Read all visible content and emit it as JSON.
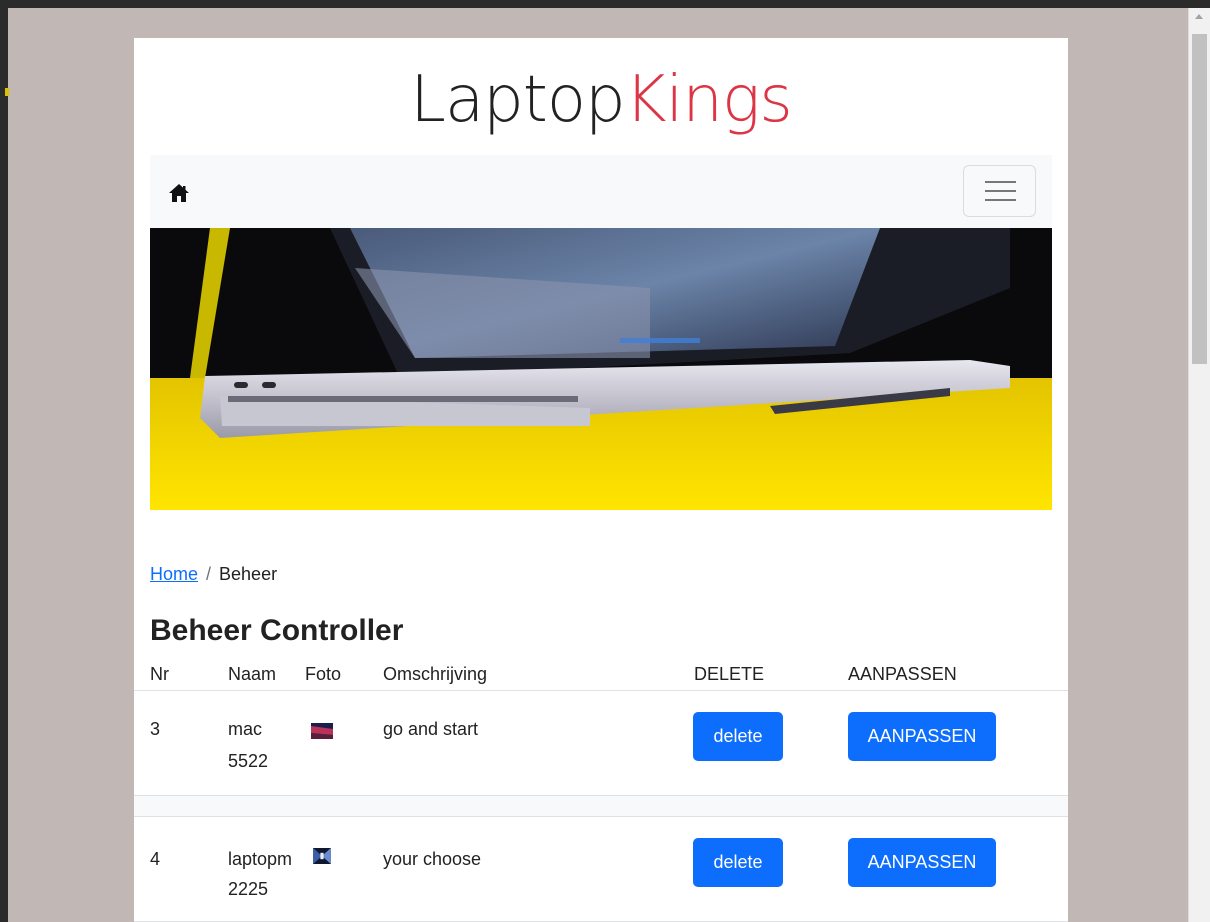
{
  "brand": {
    "part1": "Laptop",
    "part2": "Kings"
  },
  "navbar": {
    "home_icon": "home-icon",
    "toggler_icon": "hamburger-icon"
  },
  "breadcrumb": {
    "home": "Home",
    "separator": "/",
    "current": "Beheer"
  },
  "page_title": "Beheer Controller",
  "table": {
    "headers": [
      "Nr",
      "Naam",
      "Foto",
      "Omschrijving",
      "DELETE",
      "AANPASSEN"
    ],
    "rows": [
      {
        "nr": "3",
        "naam_line1": "mac",
        "naam_line2": "5522",
        "omschrijving": "go and start",
        "delete": "delete",
        "aanpassen": "AANPASSEN"
      },
      {
        "nr": "4",
        "naam_line1": "laptopm",
        "naam_line2": "2225",
        "omschrijving": "your choose",
        "delete": "delete",
        "aanpassen": "AANPASSEN"
      }
    ]
  },
  "colors": {
    "brand_accent": "#dc3545",
    "primary": "#0d6efd",
    "navbar_bg": "#f8f9fa"
  }
}
